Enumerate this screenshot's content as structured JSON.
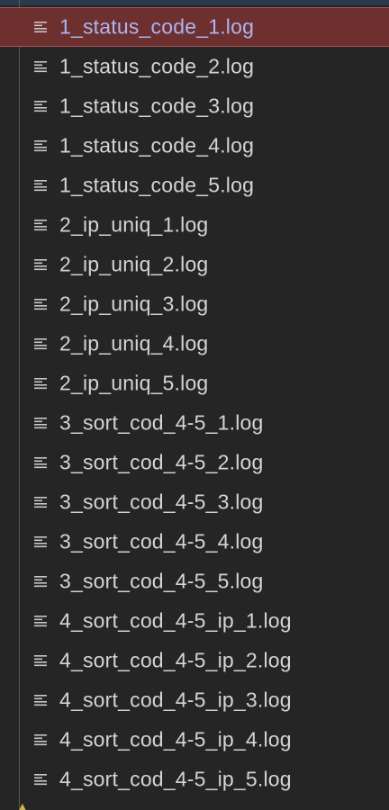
{
  "panel": {
    "selected_index": 0,
    "icon": "file-lines-icon",
    "accent_selected_bg": "#6e2f2f",
    "accent_selected_text": "#aab6f0"
  },
  "files": [
    {
      "label": "1_status_code_1.log"
    },
    {
      "label": "1_status_code_2.log"
    },
    {
      "label": "1_status_code_3.log"
    },
    {
      "label": "1_status_code_4.log"
    },
    {
      "label": "1_status_code_5.log"
    },
    {
      "label": "2_ip_uniq_1.log"
    },
    {
      "label": "2_ip_uniq_2.log"
    },
    {
      "label": "2_ip_uniq_3.log"
    },
    {
      "label": "2_ip_uniq_4.log"
    },
    {
      "label": "2_ip_uniq_5.log"
    },
    {
      "label": "3_sort_cod_4-5_1.log"
    },
    {
      "label": "3_sort_cod_4-5_2.log"
    },
    {
      "label": "3_sort_cod_4-5_3.log"
    },
    {
      "label": "3_sort_cod_4-5_4.log"
    },
    {
      "label": "3_sort_cod_4-5_5.log"
    },
    {
      "label": "4_sort_cod_4-5_ip_1.log"
    },
    {
      "label": "4_sort_cod_4-5_ip_2.log"
    },
    {
      "label": "4_sort_cod_4-5_ip_3.log"
    },
    {
      "label": "4_sort_cod_4-5_ip_4.log"
    },
    {
      "label": "4_sort_cod_4-5_ip_5.log"
    }
  ]
}
